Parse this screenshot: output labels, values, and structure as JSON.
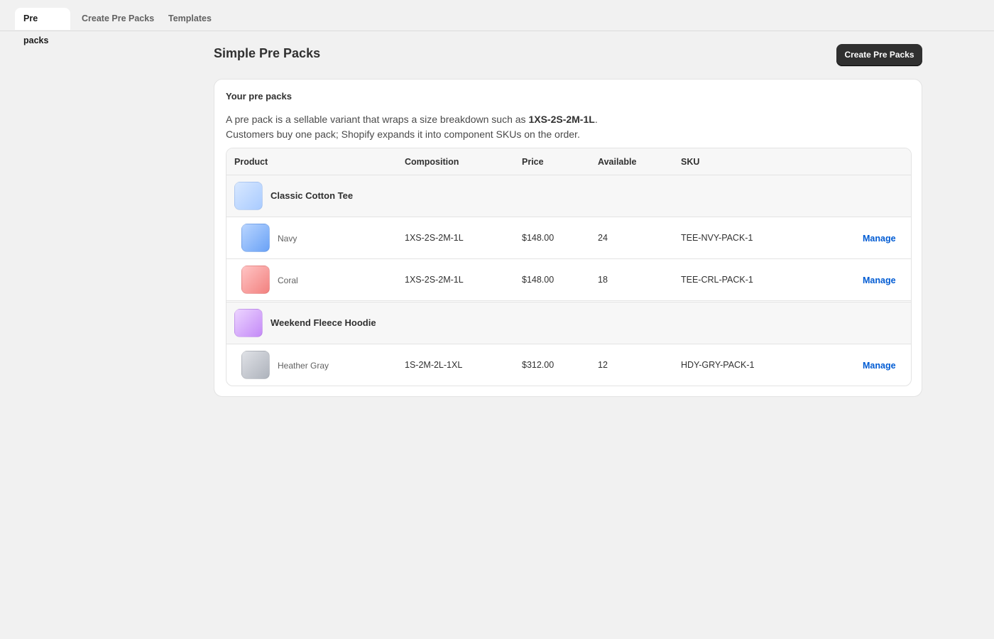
{
  "tabs": [
    {
      "label": "Pre packs",
      "active": true
    },
    {
      "label": "Create Pre Packs",
      "active": false
    },
    {
      "label": "Templates",
      "active": false
    }
  ],
  "page": {
    "title": "Simple Pre Packs",
    "primary_action": "Create Pre Packs"
  },
  "card": {
    "title": "Your pre packs",
    "desc_line1_prefix": "A pre pack is a sellable variant that wraps a size breakdown such as ",
    "desc_line1_bold": "1XS-2S-2M-1L",
    "desc_line1_suffix": ".",
    "desc_line2": "Customers buy one pack; Shopify expands it into component SKUs on the order."
  },
  "table": {
    "headers": {
      "product": "Product",
      "composition": "Composition",
      "price": "Price",
      "available": "Available",
      "sku": "SKU"
    },
    "products": [
      {
        "name": "Classic Cotton Tee",
        "swatch": "#a9cbff",
        "variants": [
          {
            "name": "Navy",
            "composition": "1XS-2S-2M-1L",
            "price": "$148.00",
            "available": "24",
            "sku": "TEE-NVY-PACK-1",
            "action": "Manage",
            "swatch": "#6aa2f6"
          },
          {
            "name": "Coral",
            "composition": "1XS-2S-2M-1L",
            "price": "$148.00",
            "available": "18",
            "sku": "TEE-CRL-PACK-1",
            "action": "Manage",
            "swatch": "#f2817f"
          }
        ]
      },
      {
        "name": "Weekend Fleece Hoodie",
        "swatch": "#c48af7",
        "variants": [
          {
            "name": "Heather Gray",
            "composition": "1S-2M-2L-1XL",
            "price": "$312.00",
            "available": "12",
            "sku": "HDY-GRY-PACK-1",
            "action": "Manage",
            "swatch": "#aeb3bc"
          }
        ]
      }
    ]
  },
  "colors": {
    "background": "#f1f1f1",
    "primary_button": "#303030",
    "link": "#005bd3"
  }
}
